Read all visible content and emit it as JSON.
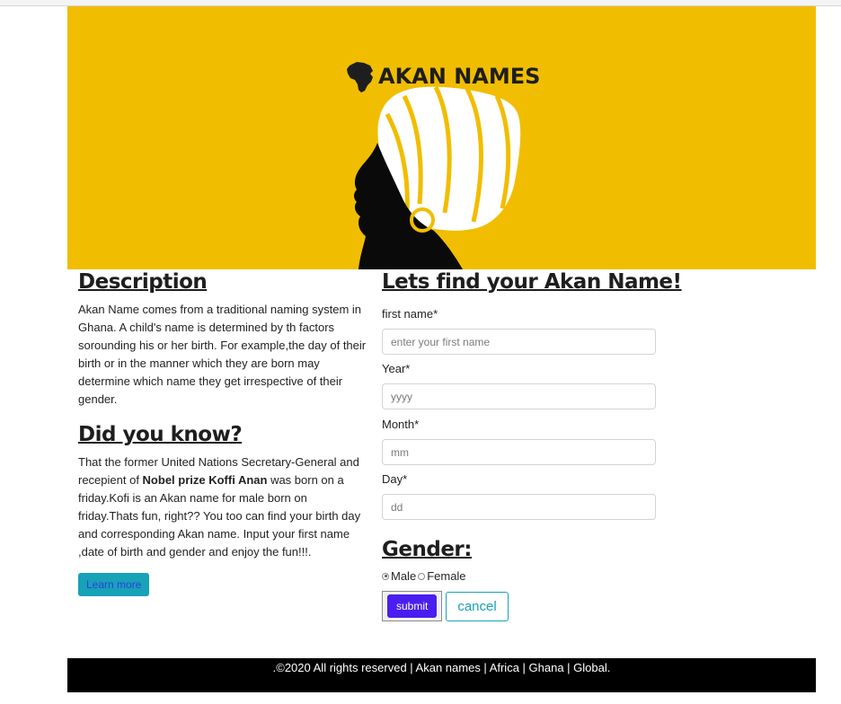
{
  "banner": {
    "logo_text": "AKAN NAMES",
    "colors": {
      "background": "#f1bd00",
      "dark": "#1e1e1e",
      "white": "#ffffff"
    },
    "icons": [
      "africa-map-icon",
      "woman-silhouette-illustration"
    ]
  },
  "description": {
    "heading": "Description",
    "text": "Akan Name comes from a traditional naming system in Ghana. A child's name is determined by th factors sorounding his or her birth. For example,the day of their birth or in the manner which they are born may determine which name they get irrespective of their gender."
  },
  "did_you_know": {
    "heading": "Did you know?",
    "text_before": "That the former United Nations Secretary-General and recepient of ",
    "bold": "Nobel prize Koffi Anan",
    "text_after": " was born on a friday.Kofi is an Akan name for male born on friday.Thats fun, right?? You too can find your birth day and corresponding Akan name. Input your first name ,date of birth and gender and enjoy the fun!!!.",
    "button_label": "Learn more"
  },
  "form": {
    "heading": "Lets find your Akan Name!",
    "fields": [
      {
        "label": "first name*",
        "placeholder": "enter your first name"
      },
      {
        "label": "Year*",
        "placeholder": "yyyy"
      },
      {
        "label": "Month*",
        "placeholder": "mm"
      },
      {
        "label": "Day*",
        "placeholder": "dd"
      }
    ],
    "gender_heading": "Gender:",
    "gender_options": [
      {
        "label": "Male",
        "selected": true
      },
      {
        "label": "Female",
        "selected": false
      }
    ],
    "submit_label": "submit",
    "cancel_label": "cancel"
  },
  "footer": {
    "text": ".©2020 All rights reserved | Akan names | Africa | Ghana | Global."
  },
  "colors": {
    "accent_teal": "#17a2b8",
    "submit_purple": "#4a1ef0",
    "footer_bg": "#000000"
  }
}
